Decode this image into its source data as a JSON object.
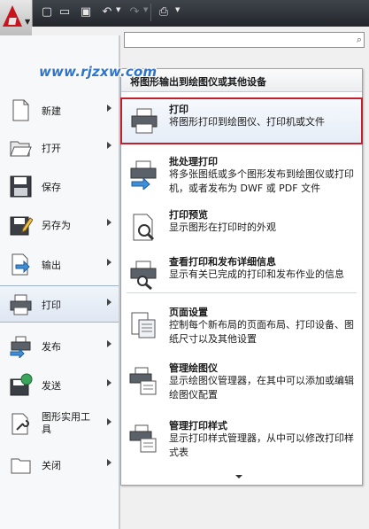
{
  "watermark": "www.rjzxw.com",
  "toolbar": {
    "buttons": [
      {
        "name": "new-icon",
        "glyph": "▢"
      },
      {
        "name": "open-icon",
        "glyph": "▭"
      },
      {
        "name": "save-icon",
        "glyph": "▣"
      },
      {
        "name": "undo-icon",
        "glyph": "↶"
      },
      {
        "name": "redo-icon",
        "glyph": "↷"
      },
      {
        "name": "plot-icon",
        "glyph": "⎙"
      }
    ]
  },
  "left_menu": {
    "items": [
      {
        "name": "new",
        "label": "新建",
        "icon": "new-document-icon",
        "arrow": true
      },
      {
        "name": "open",
        "label": "打开",
        "icon": "folder-open-icon",
        "arrow": true
      },
      {
        "name": "save",
        "label": "保存",
        "icon": "floppy-disk-icon",
        "arrow": false
      },
      {
        "name": "saveas",
        "label": "另存为",
        "icon": "save-as-icon",
        "arrow": true
      },
      {
        "name": "export",
        "label": "输出",
        "icon": "export-icon",
        "arrow": true
      },
      {
        "name": "print",
        "label": "打印",
        "icon": "printer-icon",
        "arrow": true,
        "selected": true
      },
      {
        "name": "publish",
        "label": "发布",
        "icon": "publish-icon",
        "arrow": true
      },
      {
        "name": "send",
        "label": "发送",
        "icon": "send-globe-icon",
        "arrow": true
      },
      {
        "name": "utilities",
        "label": "图形实用工具",
        "icon": "wrench-icon",
        "arrow": true
      },
      {
        "name": "close",
        "label": "关闭",
        "icon": "close-document-icon",
        "arrow": true
      }
    ]
  },
  "submenu": {
    "title": "将图形输出到绘图仪或其他设备",
    "items": [
      {
        "name": "plot",
        "title": "打印",
        "desc": "将图形打印到绘图仪、打印机或文件",
        "icon": "printer-icon",
        "highlighted": true
      },
      {
        "name": "batch-plot",
        "title": "批处理打印",
        "desc": "将多张图纸或多个图形发布到绘图仪或打印机，或者发布为 DWF 或 PDF 文件",
        "icon": "batch-plot-icon"
      },
      {
        "name": "plot-preview",
        "title": "打印预览",
        "desc": "显示图形在打印时的外观",
        "icon": "plot-preview-icon"
      },
      {
        "name": "plot-details",
        "title": "查看打印和发布详细信息",
        "desc": "显示有关已完成的打印和发布作业的信息",
        "icon": "plot-details-icon"
      },
      {
        "name": "page-setup",
        "title": "页面设置",
        "desc": "控制每个新布局的页面布局、打印设备、图纸尺寸以及其他设置",
        "icon": "page-setup-icon"
      },
      {
        "name": "plotter-manager",
        "title": "管理绘图仪",
        "desc": "显示绘图仪管理器，在其中可以添加或编辑绘图仪配置",
        "icon": "plotter-manager-icon"
      },
      {
        "name": "plot-style-manager",
        "title": "管理打印样式",
        "desc": "显示打印样式管理器，从中可以修改打印样式表",
        "icon": "plot-style-manager-icon"
      }
    ]
  }
}
